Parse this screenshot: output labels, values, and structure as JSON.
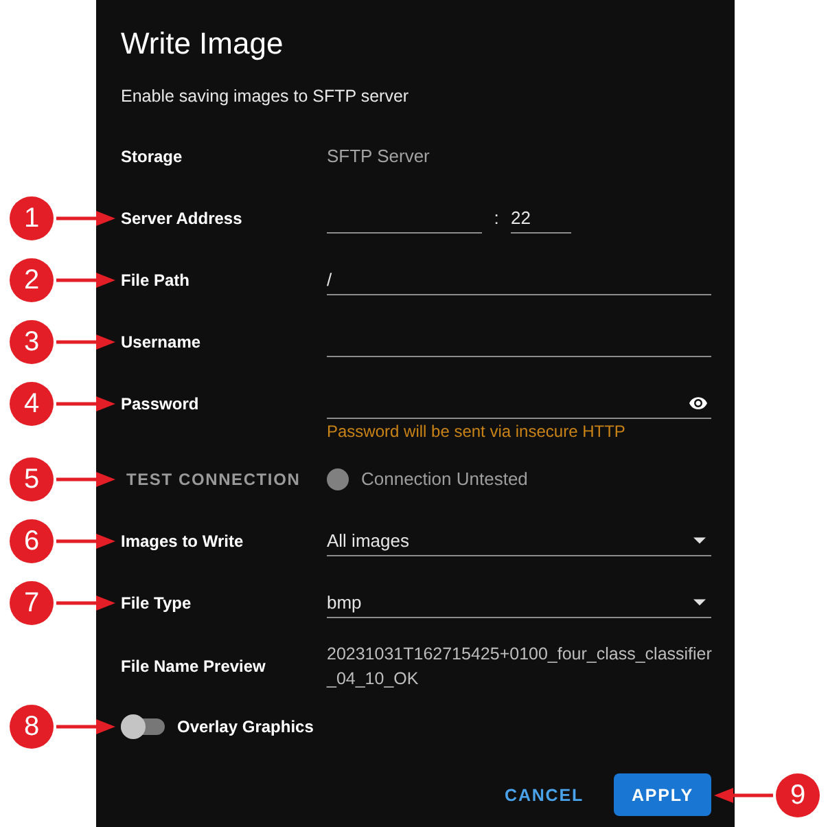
{
  "dialog": {
    "title": "Write Image",
    "subtitle": "Enable saving images to SFTP server"
  },
  "fields": [
    {
      "kind": "static",
      "label": "Storage",
      "value": "SFTP Server"
    },
    {
      "kind": "address",
      "label": "Server Address",
      "callout": "1",
      "separator": ":",
      "port": "22"
    },
    {
      "kind": "text",
      "label": "File Path",
      "callout": "2",
      "value": "/"
    },
    {
      "kind": "text",
      "label": "Username",
      "callout": "3"
    },
    {
      "kind": "password",
      "label": "Password",
      "callout": "4",
      "hint": "Password will be sent via insecure HTTP"
    },
    {
      "kind": "test",
      "button": "TEST CONNECTION",
      "disabled": true,
      "callout": "5",
      "status": "Connection Untested",
      "color": "#808080"
    },
    {
      "kind": "select",
      "label": "Images to Write",
      "callout": "6",
      "value": "All images"
    },
    {
      "kind": "select",
      "label": "File Type",
      "callout": "7",
      "value": "bmp"
    },
    {
      "kind": "preview",
      "label": "File Name Preview",
      "value": "20231031T162715425+0100_four_class_classifier_04_10_OK"
    },
    {
      "kind": "toggle",
      "label": "Overlay Graphics",
      "callout": "8",
      "on": false
    }
  ],
  "actions": [
    {
      "kind": "text",
      "label": "CANCEL"
    },
    {
      "kind": "contained",
      "label": "APPLY",
      "callout": "9"
    }
  ]
}
